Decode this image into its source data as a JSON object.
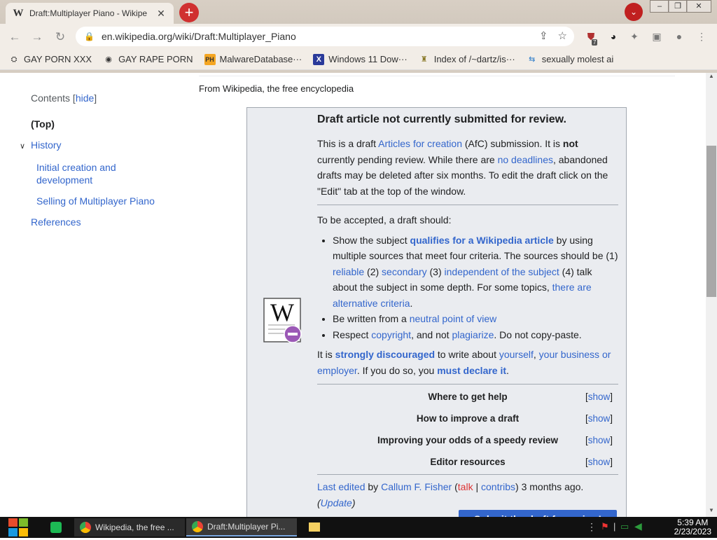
{
  "browser": {
    "tab_title": "Draft:Multiplayer Piano - Wikipe",
    "url": "en.wikipedia.org/wiki/Draft:Multiplayer_Piano",
    "extension_badge": "7",
    "window_minimize": "–",
    "window_restore": "❐",
    "window_close": "✕"
  },
  "bookmarks": [
    {
      "label": "GAY PORN XXX",
      "icon": "⛭"
    },
    {
      "label": "GAY RAPE PORN",
      "icon": "◉"
    },
    {
      "label": "MalwareDatabase···",
      "icon": "PH"
    },
    {
      "label": "Windows 11 Dow···",
      "icon": "X"
    },
    {
      "label": "Index of /~dartz/is···",
      "icon": "♜"
    },
    {
      "label": "sexually molest ai",
      "icon": "⇆"
    }
  ],
  "toc": {
    "heading": "Contents",
    "hide": "hide",
    "items": [
      {
        "label": "(Top)"
      },
      {
        "label": "History"
      },
      {
        "label": "Initial creation and development"
      },
      {
        "label": "Selling of Multiplayer Piano"
      },
      {
        "label": "References"
      }
    ]
  },
  "article": {
    "from": "From Wikipedia, the free encyclopedia"
  },
  "afc": {
    "title": "Draft article not currently submitted for review.",
    "p1_a": "This is a draft ",
    "p1_link1": "Articles for creation",
    "p1_b": " (AfC) submission. It is ",
    "p1_bold": "not",
    "p1_c": " currently pending review. While there are ",
    "p1_link2": "no deadlines",
    "p1_d": ", abandoned drafts may be deleted after six months. To edit the draft click on the \"Edit\" tab at the top of the window.",
    "accept_intro": "To be accepted, a draft should:",
    "li1_a": "Show the subject ",
    "li1_link": "qualifies for a Wikipedia article",
    "li1_b": " by using multiple sources that meet four criteria. The sources should be (1) ",
    "li1_reliable": "reliable",
    "li1_c": " (2) ",
    "li1_secondary": "secondary",
    "li1_d": " (3) ",
    "li1_independent": "independent of the subject",
    "li1_e": " (4) talk about the subject in some depth. For some topics, ",
    "li1_alt": "there are alternative criteria",
    "li1_f": ".",
    "li2_a": "Be written from a ",
    "li2_link": "neutral point of view",
    "li3_a": "Respect ",
    "li3_link1": "copyright",
    "li3_b": ", and not ",
    "li3_link2": "plagiarize",
    "li3_c": ". Do not copy-paste.",
    "p2_a": "It is ",
    "p2_link1": "strongly discouraged",
    "p2_b": " to write about ",
    "p2_link2": "yourself",
    "p2_c": ", ",
    "p2_link3": "your business or employer",
    "p2_d": ". If you do so, you ",
    "p2_link4": "must declare it",
    "p2_e": ".",
    "sections": [
      {
        "label": "Where to get help",
        "show": "show"
      },
      {
        "label": "How to improve a draft",
        "show": "show"
      },
      {
        "label": "Improving your odds of a speedy review",
        "show": "show"
      },
      {
        "label": "Editor resources",
        "show": "show"
      }
    ],
    "last_edited": "Last edited",
    "by": " by ",
    "editor": "Callum F. Fisher",
    "talk": "talk",
    "contribs": "contribs",
    "ago": " 3 months ago.",
    "update": "Update",
    "submit": "Submit the draft for review!"
  },
  "taskbar": {
    "items": [
      "Wikipedia, the free ...",
      "Draft:Multiplayer Pi..."
    ],
    "time": "5:39 AM",
    "date": "2/23/2023"
  }
}
